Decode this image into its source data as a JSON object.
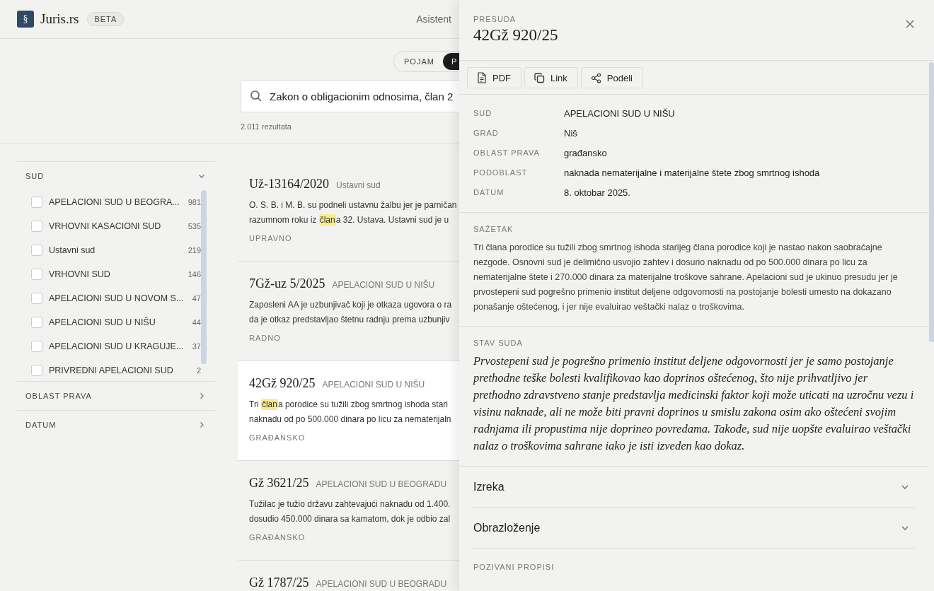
{
  "header": {
    "logo_mark": "§",
    "brand": "Juris.rs",
    "badge": "BETA",
    "nav": [
      {
        "label": "Asistent"
      }
    ]
  },
  "search": {
    "modes": [
      {
        "label": "POJAM",
        "selected": false
      },
      {
        "label": "P",
        "selected": true
      }
    ],
    "query": "Zakon o obligacionim odnosima, član 2",
    "result_count": "2.011 rezultata"
  },
  "filters": [
    {
      "title": "SUD",
      "expanded": true,
      "items": [
        {
          "label": "APELACIONI SUD U BEOGRA...",
          "count": "981",
          "checked": false
        },
        {
          "label": "VRHOVNI KASACIONI SUD",
          "count": "535",
          "checked": false
        },
        {
          "label": "Ustavni sud",
          "count": "219",
          "checked": false
        },
        {
          "label": "VRHOVNI SUD",
          "count": "146",
          "checked": false
        },
        {
          "label": "APELACIONI SUD U NOVOM S...",
          "count": "47",
          "checked": false
        },
        {
          "label": "APELACIONI SUD U NIŠU",
          "count": "44",
          "checked": false
        },
        {
          "label": "APELACIONI SUD U KRAGUJE...",
          "count": "37",
          "checked": false
        },
        {
          "label": "PRIVREDNI APELACIONI SUD",
          "count": "2",
          "checked": false
        }
      ]
    },
    {
      "title": "OBLAST PRAVA",
      "expanded": false
    },
    {
      "title": "DATUM",
      "expanded": false
    }
  ],
  "results": [
    {
      "case": "Už-13164/2020",
      "court": "Ustavni sud",
      "selected": false,
      "snippet": [
        {
          "pre": "O. S. B. i M. B. su podneli ustavnu žalbu jer je parničan"
        },
        {
          "pre": "razumnom roku iz ",
          "match": "član",
          "post": "a 32. Ustava. Ustavni sud je u"
        }
      ],
      "area": "UPRAVNO"
    },
    {
      "case": "7Gž-uz 5/2025",
      "court": "APELACIONI SUD U NIŠU",
      "selected": false,
      "snippet": [
        {
          "pre": "Zaposleni AA je uzbunjivač koji je otkaza ugovora o ra"
        },
        {
          "pre": "da je otkaz predstavljao štetnu radnju prema uzbunjiv"
        }
      ],
      "area": "RADNO"
    },
    {
      "case": "42Gž 920/25",
      "court": "APELACIONI SUD U NIŠU",
      "selected": true,
      "snippet": [
        {
          "pre": "Tri ",
          "match": "član",
          "post": "a porodice su tužili zbog smrtnog ishoda stari"
        },
        {
          "pre": "naknadu od po 500.000 dinara po licu za nematerijaln"
        }
      ],
      "area": "GRAĐANSKO"
    },
    {
      "case": "Gž 3621/25",
      "court": "APELACIONI SUD U BEOGRADU",
      "selected": false,
      "snippet": [
        {
          "pre": "Tužilac je tužio državu zahtevajući naknadu od 1.400."
        },
        {
          "pre": "dosudio 450.000 dinara sa kamatom, dok je odbio zal"
        }
      ],
      "area": "GRAĐANSKO"
    },
    {
      "case": "Gž 1787/25",
      "court": "APELACIONI SUD U BEOGRADU",
      "selected": false
    }
  ],
  "detail": {
    "kicker": "PRESUDA",
    "title": "42Gž 920/25",
    "actions": [
      {
        "label": "PDF",
        "kind": "pdf"
      },
      {
        "label": "Link",
        "kind": "copy"
      },
      {
        "label": "Podeli",
        "kind": "share"
      }
    ],
    "meta": [
      {
        "label": "SUD",
        "value": "APELACIONI SUD U NIŠU"
      },
      {
        "label": "GRAD",
        "value": "Niš"
      },
      {
        "label": "OBLAST PRAVA",
        "value": "građansko"
      },
      {
        "label": "PODOBLAST",
        "value": "naknada nematerijalne i materijalne štete zbog smrtnog ishoda"
      },
      {
        "label": "DATUM",
        "value": "8. oktobar 2025."
      }
    ],
    "summary_title": "SAŽETAK",
    "summary": "Tri člana porodice su tužili zbog smrtnog ishoda starijeg člana porodice koji je nastao nakon saobraćajne nezgode. Osnovni sud je delimično usvojio zahtev i dosurio naknadu od po 500.000 dinara po licu za nematerijalne štete i 270.000 dinara za materijalne troškove sahrane. Apelacioni sud je ukinuo presudu jer je prvostepeni sud pogrešno primenio institut deljene odgovornosti na postojanje bolesti umesto na dokazano ponašanje oštećenog, i jer nije evaluirao veštački nalaz o troškovima.",
    "position_title": "STAV SUDA",
    "position": "Prvostepeni sud je pogrešno primenio institut deljene odgovornosti jer je samo postojanje prethodne teške bolesti kvalifikovao kao doprinos oštećenog, što nije prihvatljivo jer prethodno zdravstveno stanje predstavlja medicinski faktor koji može uticati na uzročnu vezu i visinu naknade, ali ne može biti pravni doprinos u smislu zakona osim ako oštećeni svojim radnjama ili propustima nije doprineo povredama. Takođe, sud nije uopšte evaluirao veštački nalaz o troškovima sahrane iako je isti izveden kao dokaz.",
    "sections": [
      {
        "title": "Izreka",
        "expanded": false
      },
      {
        "title": "Obrazloženje",
        "expanded": false
      }
    ],
    "cited_title": "POZIVANI PROPISI"
  }
}
